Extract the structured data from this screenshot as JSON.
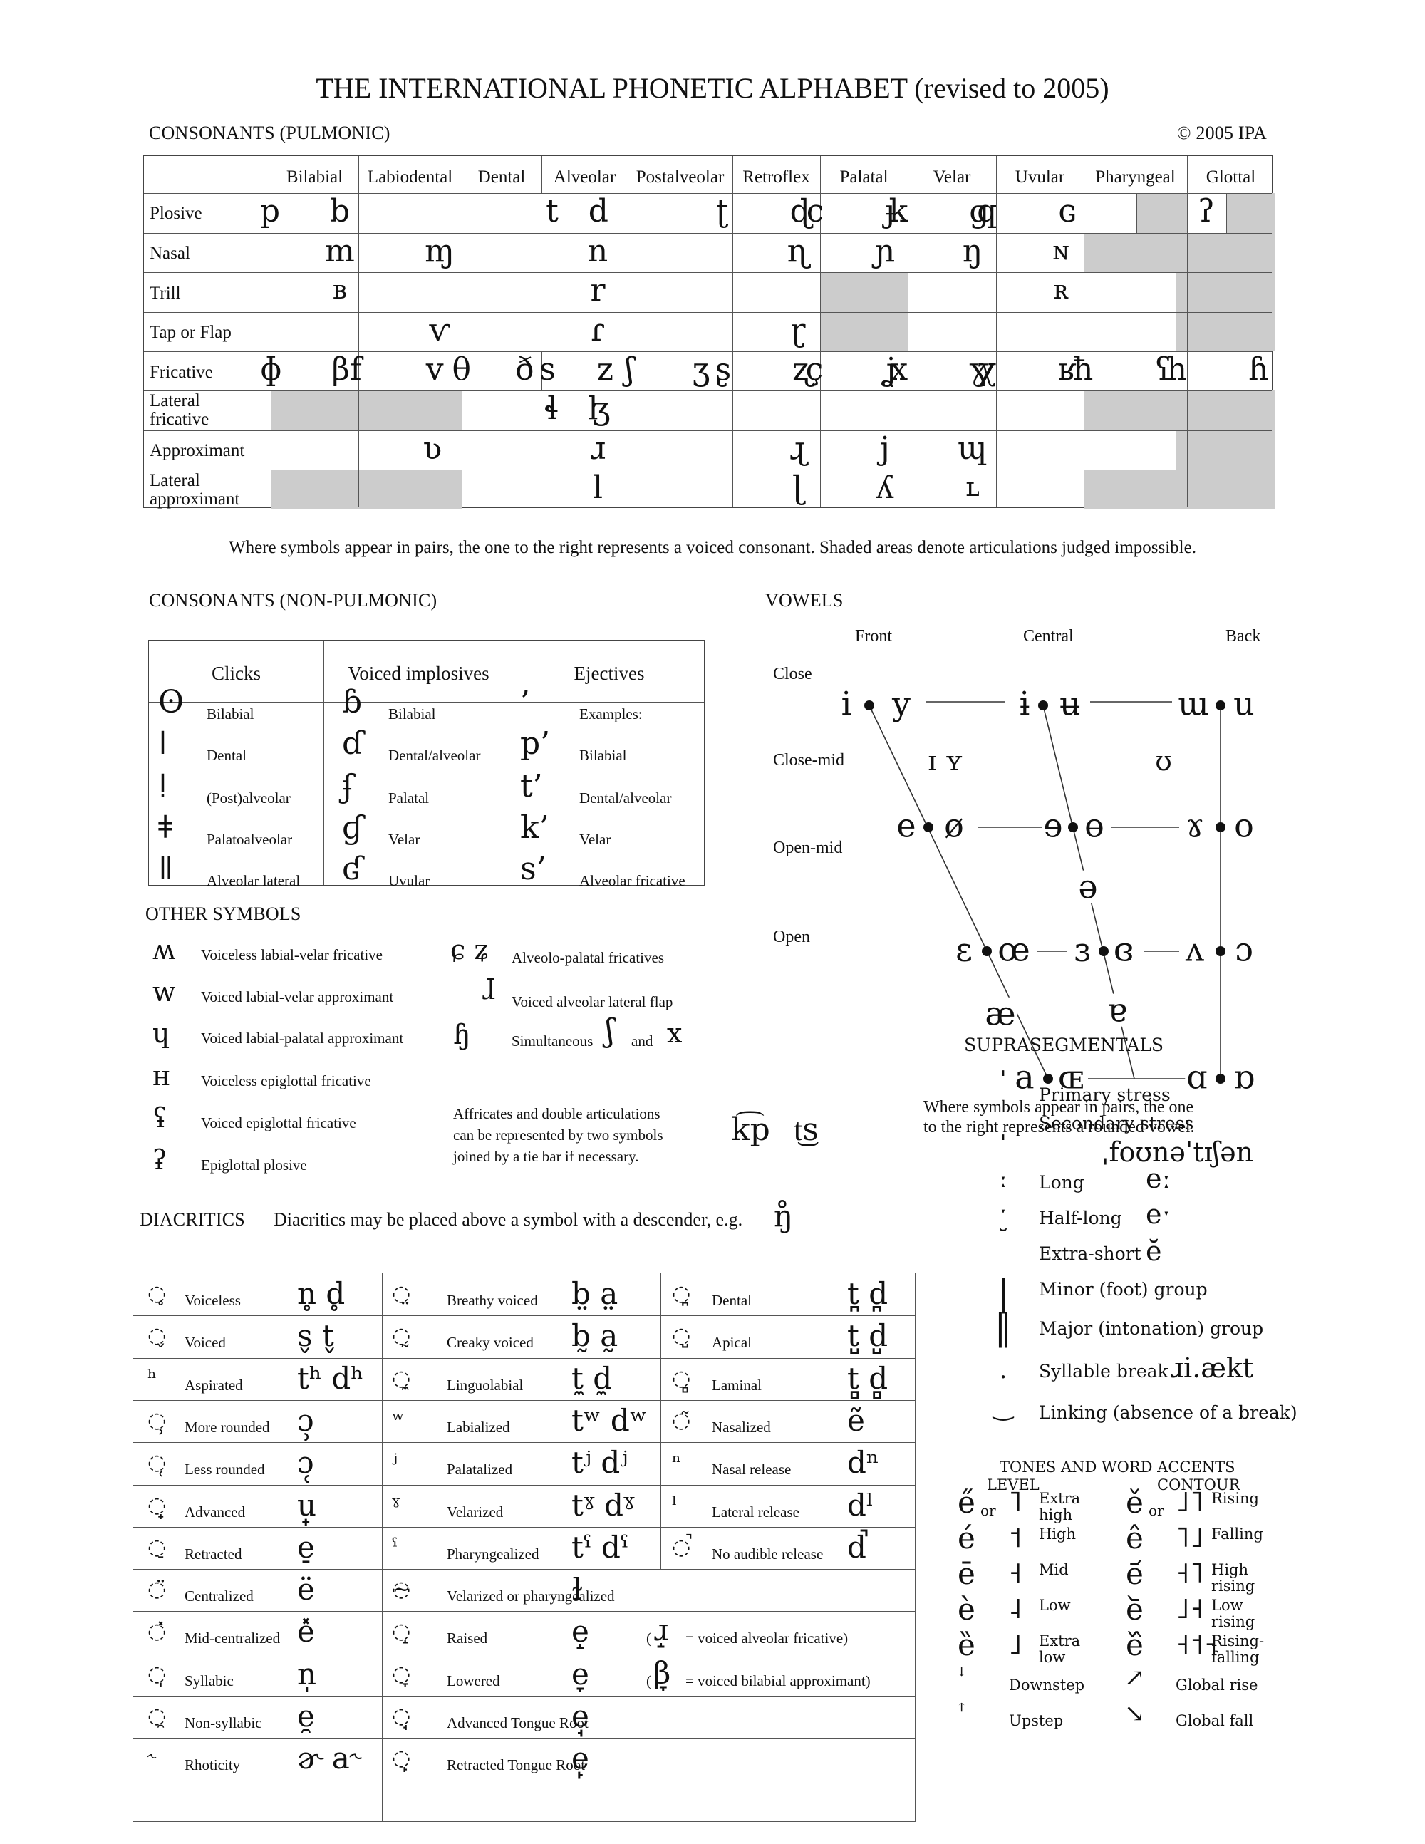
{
  "title": "THE INTERNATIONAL PHONETIC ALPHABET (revised to 2005)",
  "copyright": "© 2005 IPA",
  "pulmonic": {
    "heading": "CONSONANTS (PULMONIC)",
    "columns": [
      "Bilabial",
      "Labiodental",
      "Dental",
      "Alveolar",
      "Postalveolar",
      "Retroflex",
      "Palatal",
      "Velar",
      "Uvular",
      "Pharyngeal",
      "Glottal"
    ],
    "rows": [
      "Plosive",
      "Nasal",
      "Trill",
      "Tap or Flap",
      "Fricative",
      "Lateral fricative",
      "Approximant",
      "Lateral approximant"
    ],
    "symbols": {
      "plosive": {
        "bilabial": "p b",
        "alveolar": "t d",
        "retroflex": "ʈ ɖ",
        "palatal": "c ɟ",
        "velar": "k ɡ",
        "uvular": "q ɢ",
        "glottal": "ʔ"
      },
      "nasal": {
        "bilabial": "m",
        "labiodental": "ɱ",
        "alveolar": "n",
        "retroflex": "ɳ",
        "palatal": "ɲ",
        "velar": "ŋ",
        "uvular": "ɴ"
      },
      "trill": {
        "bilabial": "ʙ",
        "alveolar": "r",
        "uvular": "ʀ"
      },
      "tap": {
        "labiodental": "ⱱ",
        "alveolar": "ɾ",
        "retroflex": "ɽ"
      },
      "fricative": {
        "bilabial": "ɸ β",
        "labiodental": "f v",
        "dental": "θ ð",
        "alveolar": "s z",
        "postalveolar": "ʃ ʒ",
        "retroflex": "ʂ ʐ",
        "palatal": "ç ʝ",
        "velar": "x ɣ",
        "uvular": "χ ʁ",
        "pharyngeal": "ħ ʕ",
        "glottal": "h ɦ"
      },
      "lateral_fricative": {
        "alveolar": "ɬ ɮ"
      },
      "approximant": {
        "labiodental": "ʋ",
        "alveolar": "ɹ",
        "retroflex": "ɻ",
        "palatal": "j",
        "velar": "ɰ"
      },
      "lateral_approximant": {
        "alveolar": "l",
        "retroflex": "ɭ",
        "palatal": "ʎ",
        "velar": "ʟ"
      }
    },
    "note": "Where symbols appear in pairs, the one to the right represents a voiced consonant. Shaded areas denote articulations judged impossible."
  },
  "nonpulmonic": {
    "heading": "CONSONANTS (NON-PULMONIC)",
    "headers": [
      "Clicks",
      "Voiced implosives",
      "Ejectives"
    ],
    "clicks": [
      {
        "sym": "ʘ",
        "label": "Bilabial"
      },
      {
        "sym": "ǀ",
        "label": "Dental"
      },
      {
        "sym": "ǃ",
        "label": "(Post)alveolar"
      },
      {
        "sym": "ǂ",
        "label": "Palatoalveolar"
      },
      {
        "sym": "ǁ",
        "label": "Alveolar lateral"
      }
    ],
    "implosives": [
      {
        "sym": "ɓ",
        "label": "Bilabial"
      },
      {
        "sym": "ɗ",
        "label": "Dental/alveolar"
      },
      {
        "sym": "ʄ",
        "label": "Palatal"
      },
      {
        "sym": "ɠ",
        "label": "Velar"
      },
      {
        "sym": "ʛ",
        "label": "Uvular"
      }
    ],
    "ejectives": [
      {
        "sym": "’",
        "label": "Examples:"
      },
      {
        "sym": "p’",
        "label": "Bilabial"
      },
      {
        "sym": "t’",
        "label": "Dental/alveolar"
      },
      {
        "sym": "k’",
        "label": "Velar"
      },
      {
        "sym": "s’",
        "label": "Alveolar fricative"
      }
    ]
  },
  "vowels": {
    "heading": "VOWELS",
    "columns": [
      "Front",
      "Central",
      "Back"
    ],
    "rows": [
      "Close",
      "Close-mid",
      "Open-mid",
      "Open"
    ],
    "symbols": {
      "close_front": [
        "i",
        "y"
      ],
      "close_central": [
        "ɨ",
        "ʉ"
      ],
      "close_back": [
        "ɯ",
        "u"
      ],
      "near_close_front": "ɪ ʏ",
      "near_close_back": "ʊ",
      "closemid_front": [
        "e",
        "ø"
      ],
      "closemid_central": [
        "ɘ",
        "ɵ"
      ],
      "closemid_back": [
        "ɤ",
        "o"
      ],
      "mid_central": "ə",
      "openmid_front": [
        "ɛ",
        "œ"
      ],
      "openmid_central": [
        "ɜ",
        "ɞ"
      ],
      "openmid_back": [
        "ʌ",
        "ɔ"
      ],
      "near_open_front": "æ",
      "near_open_central": "ɐ",
      "open_front": [
        "a",
        "ɶ"
      ],
      "open_back": [
        "ɑ",
        "ɒ"
      ]
    },
    "note_line1": "Where symbols appear in pairs, the one",
    "note_line2": "to the right represents a rounded vowel."
  },
  "other": {
    "heading": "OTHER SYMBOLS",
    "left": [
      {
        "sym": "ʍ",
        "label": "Voiceless labial-velar fricative"
      },
      {
        "sym": "w",
        "label": "Voiced labial-velar approximant"
      },
      {
        "sym": "ɥ",
        "label": "Voiced labial-palatal approximant"
      },
      {
        "sym": "ʜ",
        "label": "Voiceless epiglottal fricative"
      },
      {
        "sym": "ʢ",
        "label": "Voiced epiglottal fricative"
      },
      {
        "sym": "ʡ",
        "label": "Epiglottal plosive"
      }
    ],
    "right": [
      {
        "sym": "ɕ ʑ",
        "label": "Alveolo-palatal fricatives"
      },
      {
        "sym": "ɺ",
        "label": "Voiced alveolar lateral flap"
      },
      {
        "sym": "ɧ",
        "label": "Simultaneous",
        "sym2": "ʃ",
        "and": "and",
        "sym3": "x"
      }
    ],
    "affricate_note": [
      "Affricates and double articulations",
      "can be represented by two symbols",
      "joined by a tie bar if necessary."
    ],
    "tie_examples": [
      "k͡p",
      "t͜s"
    ]
  },
  "diacritics": {
    "heading": "DIACRITICS",
    "subheading": "Diacritics may be placed above a symbol with a descender, e.g.",
    "subheading_example": "ŋ̊",
    "col1": [
      {
        "mark": "̥",
        "label": "Voiceless",
        "ex": "n̥  d̥"
      },
      {
        "mark": "̬",
        "label": "Voiced",
        "ex": "s̬  t̬"
      },
      {
        "mark": "ʰ",
        "label": "Aspirated",
        "ex": "tʰ dʰ"
      },
      {
        "mark": "̹",
        "label": "More rounded",
        "ex": "ɔ̹"
      },
      {
        "mark": "̜",
        "label": "Less rounded",
        "ex": "ɔ̜"
      },
      {
        "mark": "̟",
        "label": "Advanced",
        "ex": "u̟"
      },
      {
        "mark": "̠",
        "label": "Retracted",
        "ex": "e̠"
      },
      {
        "mark": "̈",
        "label": "Centralized",
        "ex": "ë"
      },
      {
        "mark": "̽",
        "label": "Mid-centralized",
        "ex": "e̽"
      },
      {
        "mark": "̩",
        "label": "Syllabic",
        "ex": "n̩"
      },
      {
        "mark": "̯",
        "label": "Non-syllabic",
        "ex": "e̯"
      },
      {
        "mark": "˞",
        "label": "Rhoticity",
        "ex": "ɚ  a˞"
      }
    ],
    "col2": [
      {
        "mark": "̤",
        "label": "Breathy voiced",
        "ex": "b̤  a̤"
      },
      {
        "mark": "̰",
        "label": "Creaky voiced",
        "ex": "b̰  a̰"
      },
      {
        "mark": "̼",
        "label": "Linguolabial",
        "ex": "t̼  d̼"
      },
      {
        "mark": "ʷ",
        "label": "Labialized",
        "ex": "tʷ dʷ"
      },
      {
        "mark": "ʲ",
        "label": "Palatalized",
        "ex": "tʲ  dʲ"
      },
      {
        "mark": "ˠ",
        "label": "Velarized",
        "ex": "tˠ dˠ"
      },
      {
        "mark": "ˤ",
        "label": "Pharyngealized",
        "ex": "tˤ  dˤ"
      },
      {
        "mark": "̴",
        "label": "Velarized or pharyngealized",
        "ex": "ɫ"
      },
      {
        "mark": "̝",
        "label": "Raised",
        "ex": "e̝",
        "paren_sym": "ɹ̝",
        "paren_text": "= voiced alveolar fricative)"
      },
      {
        "mark": "̞",
        "label": "Lowered",
        "ex": "e̞",
        "paren_sym": "β̞",
        "paren_text": "= voiced bilabial approximant)"
      },
      {
        "mark": "̘",
        "label": "Advanced Tongue Root",
        "ex": "e̘"
      },
      {
        "mark": "̙",
        "label": "Retracted Tongue Root",
        "ex": "e̙"
      }
    ],
    "col3": [
      {
        "mark": "̪",
        "label": "Dental",
        "ex": "t̪ d̪"
      },
      {
        "mark": "̺",
        "label": "Apical",
        "ex": "t̺ d̺"
      },
      {
        "mark": "̻",
        "label": "Laminal",
        "ex": "t̻ d̻"
      },
      {
        "mark": "̃",
        "label": "Nasalized",
        "ex": "ẽ"
      },
      {
        "mark": "ⁿ",
        "label": "Nasal release",
        "ex": "dⁿ"
      },
      {
        "mark": "ˡ",
        "label": "Lateral release",
        "ex": "dˡ"
      },
      {
        "mark": "̚",
        "label": "No audible release",
        "ex": "d̚"
      }
    ]
  },
  "suprasegmentals": {
    "heading": "SUPRASEGMENTALS",
    "items": [
      {
        "sym": "ˈ",
        "label": "Primary stress"
      },
      {
        "sym": "ˌ",
        "label": "Secondary stress",
        "ex": "ˌfoʊnəˈtɪʃən"
      },
      {
        "sym": "ː",
        "label": "Long",
        "ex": "eː"
      },
      {
        "sym": "ˑ",
        "label": "Half-long",
        "ex": "eˑ"
      },
      {
        "sym": "˘",
        "label": "Extra-short",
        "ex": "ĕ"
      },
      {
        "sym": "|",
        "label": "Minor (foot) group"
      },
      {
        "sym": "‖",
        "label": "Major (intonation) group"
      },
      {
        "sym": ".",
        "label": "Syllable break",
        "ex": "ɹi.ækt"
      },
      {
        "sym": "‿",
        "label": "Linking (absence of a break)"
      }
    ]
  },
  "tones": {
    "heading": "TONES AND WORD ACCENTS",
    "level_heading": "LEVEL",
    "contour_heading": "CONTOUR",
    "or": "or",
    "level": [
      {
        "sym": "e̋",
        "bar": "˥",
        "label": "Extra\nhigh",
        "or": true
      },
      {
        "sym": "é",
        "bar": "˦",
        "label": "High"
      },
      {
        "sym": "ē",
        "bar": "˧",
        "label": "Mid"
      },
      {
        "sym": "è",
        "bar": "˨",
        "label": "Low"
      },
      {
        "sym": "ȅ",
        "bar": "˩",
        "label": "Extra\nlow"
      },
      {
        "sym": "ꜜ",
        "label": "Downstep"
      },
      {
        "sym": "ꜛ",
        "label": "Upstep"
      }
    ],
    "contour": [
      {
        "sym": "ě",
        "bar": "˩˥",
        "label": "Rising",
        "or": true
      },
      {
        "sym": "ê",
        "bar": "˥˩",
        "label": "Falling"
      },
      {
        "sym": "e᷄",
        "bar": "˧˥",
        "label": "High\nrising"
      },
      {
        "sym": "e᷅",
        "bar": "˩˧",
        "label": "Low\nrising"
      },
      {
        "sym": "e᷈",
        "bar": "˧˦˧",
        "label": "Rising-\nfalling"
      },
      {
        "sym": "↗",
        "label": "Global rise"
      },
      {
        "sym": "↘",
        "label": "Global fall"
      }
    ]
  }
}
